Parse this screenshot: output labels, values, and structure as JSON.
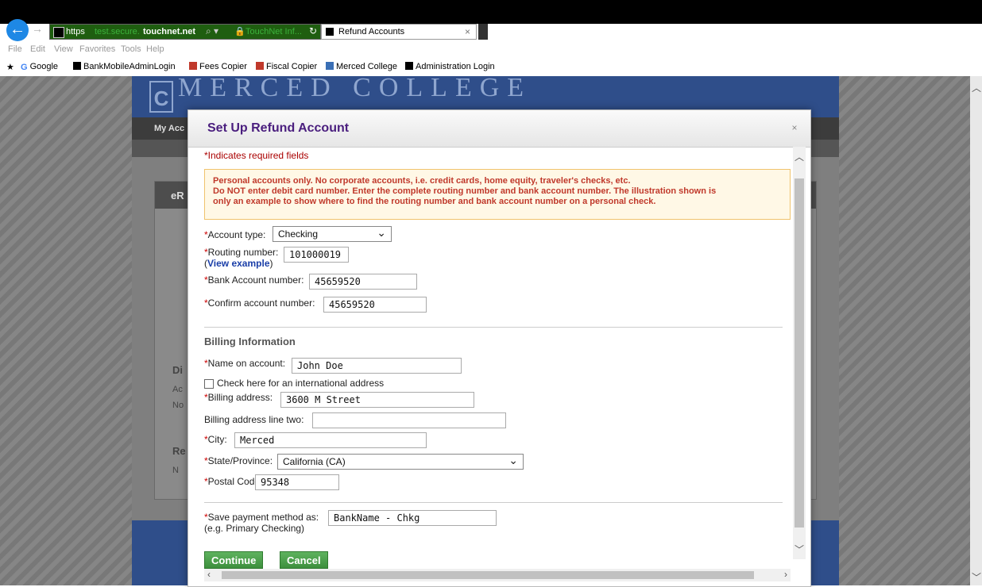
{
  "browser": {
    "address": {
      "scheme": "https",
      "subdomain": "test.secure.",
      "host": "touchnet.net",
      "site_id": "TouchNet Inf...",
      "search_icon": "magnifier-icon",
      "lock_icon": "lock-icon"
    },
    "tab": {
      "label": "Refund Accounts",
      "close": "×"
    },
    "menu": [
      "File",
      "Edit",
      "View",
      "Favorites",
      "Tools",
      "Help"
    ],
    "favorites": [
      "Google",
      "BankMobileAdminLogin",
      "Fees Copier",
      "Fiscal Copier",
      "Merced College",
      "Administration Login"
    ],
    "toolbar_icons": "⌂★⚙"
  },
  "site": {
    "name": "MERCED COLLEGE",
    "logo_text": "C",
    "nav_my_account": "My Acc",
    "panel_title": "eR",
    "ghost_labels": [
      "Di",
      "Ac",
      "No",
      "Re",
      "N"
    ]
  },
  "modal": {
    "title": "Set Up Refund Account",
    "close": "×",
    "required_note": "*Indicates required fields",
    "warning": [
      "Personal accounts only. No corporate accounts, i.e. credit cards, home equity, traveler's checks, etc.",
      "Do NOT enter debit card number. Enter the complete routing number and bank account number. The illustration shown is",
      "only an example to show where to find the routing number and bank account number on a personal check."
    ],
    "account_type_label": "Account type:",
    "account_type_value": "Checking",
    "routing_label": "Routing number:",
    "view_example": "View example",
    "routing_value": "101000019",
    "bank_account_label": "Bank Account number:",
    "bank_account_value": "45659520",
    "confirm_label": "Confirm account number:",
    "confirm_value": "45659520",
    "billing_heading": "Billing Information",
    "name_label": "Name on account:",
    "name_value": "John Doe",
    "intl_label": "Check here for an international address",
    "address_label": "Billing address:",
    "address_value": "3600 M Street",
    "address2_label": "Billing address line two:",
    "address2_value": "",
    "city_label": "City:",
    "city_value": "Merced",
    "state_label": "State/Province:",
    "state_value": "California (CA)",
    "postal_label": "Postal Code:",
    "postal_value": "95348",
    "save_label": "Save payment method as:",
    "save_hint": "(e.g. Primary Checking)",
    "save_value": "BankName - Chkg",
    "continue": "Continue",
    "cancel": "Cancel",
    "required_mark": "*"
  }
}
